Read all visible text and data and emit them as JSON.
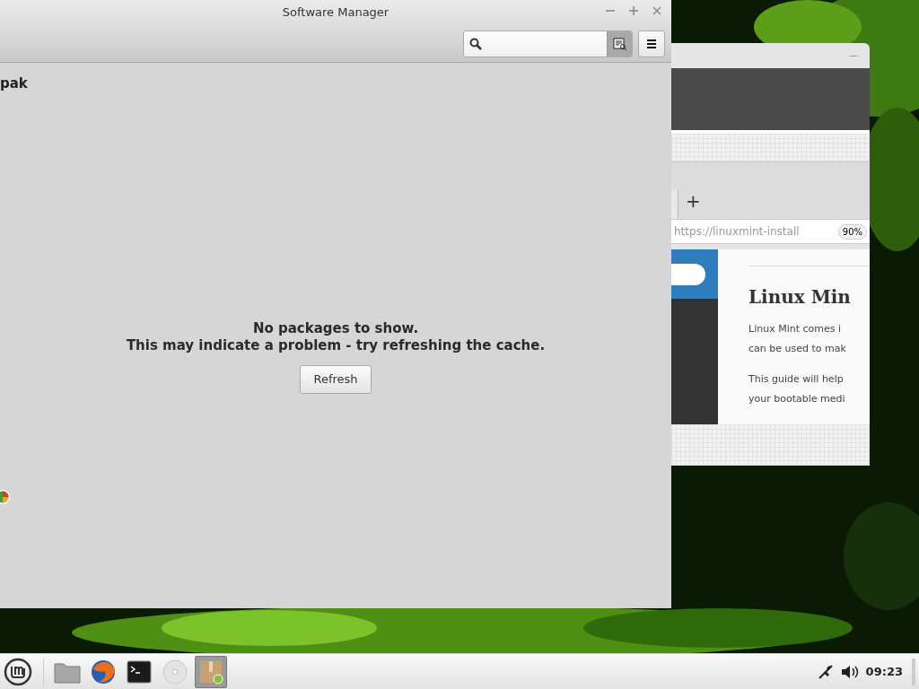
{
  "software_manager": {
    "title": "Software Manager",
    "section_heading": "pak",
    "message": [
      "No packages to show.",
      "This may indicate a problem - try refreshing the cache."
    ],
    "refresh_button": "Refresh"
  },
  "browser": {
    "new_tab": "+",
    "url": "https://linuxmint-install",
    "zoom": "90%",
    "heading": "Linux Min",
    "paragraphs": [
      [
        "Linux Mint comes i",
        "can be used to mak"
      ],
      [
        "This guide will help",
        "your bootable medi"
      ]
    ]
  },
  "taskbar": {
    "launchers": [
      {
        "kind": "folder",
        "selected": false
      },
      {
        "kind": "browser",
        "selected": false
      },
      {
        "kind": "terminal",
        "selected": false
      },
      {
        "kind": "disc",
        "selected": false
      },
      {
        "kind": "package",
        "selected": true
      }
    ],
    "clock": "09:23"
  }
}
